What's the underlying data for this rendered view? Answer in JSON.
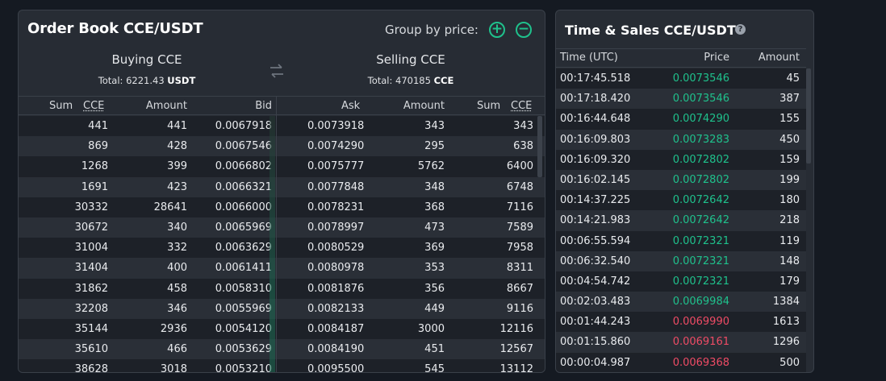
{
  "order_book": {
    "title": "Order Book CCE/USDT",
    "group_label": "Group by price:",
    "plus_glyph": "+",
    "minus_glyph": "−",
    "buying": {
      "title": "Buying CCE",
      "total_label": "Total: 6221.43",
      "total_unit": "USDT"
    },
    "selling": {
      "title": "Selling CCE",
      "total_label": "Total: 470185",
      "total_unit": "CCE"
    },
    "headers": {
      "sum": "Sum",
      "ccy": "CCE",
      "amount": "Amount",
      "bid": "Bid",
      "ask": "Ask",
      "ask_amount": "Amount",
      "ask_sum": "Sum",
      "ask_ccy": "CCE"
    },
    "rows": [
      {
        "bsum": "441",
        "bamt": "441",
        "bid": "0.0067918",
        "ask": "0.0073918",
        "aamt": "343",
        "asum": "343"
      },
      {
        "bsum": "869",
        "bamt": "428",
        "bid": "0.0067546",
        "ask": "0.0074290",
        "aamt": "295",
        "asum": "638"
      },
      {
        "bsum": "1268",
        "bamt": "399",
        "bid": "0.0066802",
        "ask": "0.0075777",
        "aamt": "5762",
        "asum": "6400"
      },
      {
        "bsum": "1691",
        "bamt": "423",
        "bid": "0.0066321",
        "ask": "0.0077848",
        "aamt": "348",
        "asum": "6748"
      },
      {
        "bsum": "30332",
        "bamt": "28641",
        "bid": "0.0066000",
        "ask": "0.0078231",
        "aamt": "368",
        "asum": "7116"
      },
      {
        "bsum": "30672",
        "bamt": "340",
        "bid": "0.0065969",
        "ask": "0.0078997",
        "aamt": "473",
        "asum": "7589"
      },
      {
        "bsum": "31004",
        "bamt": "332",
        "bid": "0.0063629",
        "ask": "0.0080529",
        "aamt": "369",
        "asum": "7958"
      },
      {
        "bsum": "31404",
        "bamt": "400",
        "bid": "0.0061411",
        "ask": "0.0080978",
        "aamt": "353",
        "asum": "8311"
      },
      {
        "bsum": "31862",
        "bamt": "458",
        "bid": "0.0058310",
        "ask": "0.0081876",
        "aamt": "356",
        "asum": "8667"
      },
      {
        "bsum": "32208",
        "bamt": "346",
        "bid": "0.0055969",
        "ask": "0.0082133",
        "aamt": "449",
        "asum": "9116"
      },
      {
        "bsum": "35144",
        "bamt": "2936",
        "bid": "0.0054120",
        "ask": "0.0084187",
        "aamt": "3000",
        "asum": "12116"
      },
      {
        "bsum": "35610",
        "bamt": "466",
        "bid": "0.0053629",
        "ask": "0.0084190",
        "aamt": "451",
        "asum": "12567"
      },
      {
        "bsum": "38628",
        "bamt": "3018",
        "bid": "0.0053210",
        "ask": "0.0095500",
        "aamt": "545",
        "asum": "13112"
      }
    ]
  },
  "time_sales": {
    "title": "Time & Sales CCE/USDT",
    "help_glyph": "?",
    "headers": {
      "time": "Time (UTC)",
      "price": "Price",
      "amount": "Amount"
    },
    "rows": [
      {
        "time": "00:17:45.518",
        "price": "0.0073546",
        "amount": "45",
        "side": "buy"
      },
      {
        "time": "00:17:18.420",
        "price": "0.0073546",
        "amount": "387",
        "side": "buy"
      },
      {
        "time": "00:16:44.648",
        "price": "0.0074290",
        "amount": "155",
        "side": "buy"
      },
      {
        "time": "00:16:09.803",
        "price": "0.0073283",
        "amount": "450",
        "side": "buy"
      },
      {
        "time": "00:16:09.320",
        "price": "0.0072802",
        "amount": "159",
        "side": "buy"
      },
      {
        "time": "00:16:02.145",
        "price": "0.0072802",
        "amount": "199",
        "side": "buy"
      },
      {
        "time": "00:14:37.225",
        "price": "0.0072642",
        "amount": "180",
        "side": "buy"
      },
      {
        "time": "00:14:21.983",
        "price": "0.0072642",
        "amount": "218",
        "side": "buy"
      },
      {
        "time": "00:06:55.594",
        "price": "0.0072321",
        "amount": "119",
        "side": "buy"
      },
      {
        "time": "00:06:32.540",
        "price": "0.0072321",
        "amount": "148",
        "side": "buy"
      },
      {
        "time": "00:04:54.742",
        "price": "0.0072321",
        "amount": "179",
        "side": "buy"
      },
      {
        "time": "00:02:03.483",
        "price": "0.0069984",
        "amount": "1384",
        "side": "buy"
      },
      {
        "time": "00:01:44.243",
        "price": "0.0069990",
        "amount": "1613",
        "side": "sell"
      },
      {
        "time": "00:01:15.860",
        "price": "0.0069161",
        "amount": "1296",
        "side": "sell"
      },
      {
        "time": "00:00:04.987",
        "price": "0.0069368",
        "amount": "500",
        "side": "sell"
      }
    ]
  },
  "colors": {
    "buy": "#1fc18c",
    "sell": "#ef4b65",
    "panel": "#272c34",
    "background": "#151a22"
  },
  "icons": [
    "plus-circle-icon",
    "minus-circle-icon",
    "swap-arrows-icon",
    "help-icon"
  ]
}
